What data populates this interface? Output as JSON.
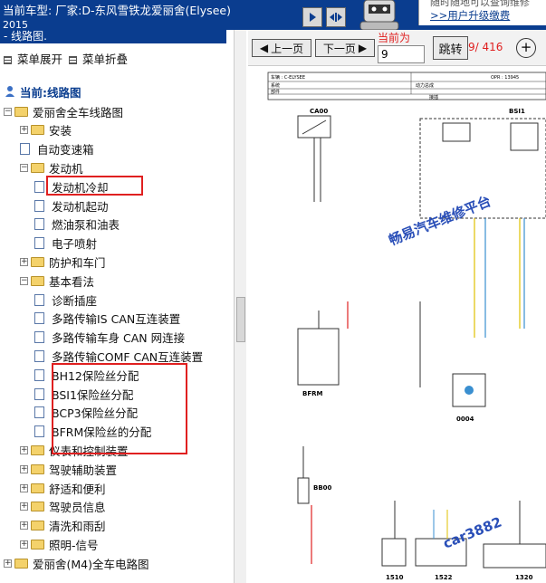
{
  "header": {
    "title": "当前车型:  厂家:D-东风雪铁龙爱丽舍(Elysee)",
    "year": "2015",
    "ad_line1": "随时随地可以查询维修",
    "ad_link": ">>用户升级缴费"
  },
  "left": {
    "tab_label": "- 线路图.",
    "expand_all": "菜单展开",
    "collapse_all": "菜单折叠",
    "current_label": "当前:线路图",
    "tree": [
      {
        "label": "爱丽舍全车线路图",
        "kind": "folder",
        "exp": "⊟"
      },
      {
        "label": "安装",
        "kind": "folder",
        "exp": "⊞"
      },
      {
        "label": "自动变速箱",
        "kind": "doc",
        "exp": ""
      },
      {
        "label": "发动机",
        "kind": "folder",
        "exp": "⊟"
      },
      {
        "label": "发动机冷却",
        "kind": "doc",
        "exp": ""
      },
      {
        "label": "发动机起动",
        "kind": "doc",
        "exp": ""
      },
      {
        "label": "燃油泵和油表",
        "kind": "doc",
        "exp": ""
      },
      {
        "label": "电子喷射",
        "kind": "doc",
        "exp": ""
      },
      {
        "label": "防护和车门",
        "kind": "folder",
        "exp": "⊞"
      },
      {
        "label": "基本看法",
        "kind": "folder",
        "exp": "⊟"
      },
      {
        "label": "诊断插座",
        "kind": "doc",
        "exp": ""
      },
      {
        "label": "多路传输IS CAN互连装置",
        "kind": "doc",
        "exp": ""
      },
      {
        "label": "多路传输车身 CAN 网连接",
        "kind": "doc",
        "exp": ""
      },
      {
        "label": "多路传输COMF CAN互连装置",
        "kind": "doc",
        "exp": ""
      },
      {
        "label": "BH12保险丝分配",
        "kind": "doc",
        "exp": ""
      },
      {
        "label": "BSI1保险丝分配",
        "kind": "doc",
        "exp": ""
      },
      {
        "label": "BCP3保险丝分配",
        "kind": "doc",
        "exp": ""
      },
      {
        "label": "BFRM保险丝的分配",
        "kind": "doc",
        "exp": ""
      },
      {
        "label": "仪表和控制装置",
        "kind": "folder",
        "exp": "⊞"
      },
      {
        "label": "驾驶辅助装置",
        "kind": "folder",
        "exp": "⊞"
      },
      {
        "label": "舒适和便利",
        "kind": "folder",
        "exp": "⊞"
      },
      {
        "label": "驾驶员信息",
        "kind": "folder",
        "exp": "⊞"
      },
      {
        "label": "清洗和雨刮",
        "kind": "folder",
        "exp": "⊞"
      },
      {
        "label": "照明-信号",
        "kind": "folder",
        "exp": "⊞"
      },
      {
        "label": "爱丽舍(M4)全车电路图",
        "kind": "folder",
        "exp": "⊞"
      }
    ]
  },
  "toolbar": {
    "prev": "上一页",
    "next": "下一页",
    "page_label": "当前为",
    "page_value": "9",
    "jump": "跳转",
    "total": "9/ 416"
  },
  "diagram": {
    "hdr_car": "车辆 : C-ELYSEE",
    "hdr_opr": "OPR : 13945",
    "hdr_sys": "系统",
    "hdr_func": "动力总成",
    "hdr_part": "部件",
    "hdr_mid": "接插",
    "ca00": "CA00",
    "bsi1": "BSI1",
    "bfrm": "BFRM",
    "bb00": "BB00",
    "c0004": "0004",
    "c1510": "1510",
    "c1522": "1522",
    "c1320": "1320",
    "watermark1": "畅易汽车维修平台",
    "watermark2": "car3882"
  }
}
